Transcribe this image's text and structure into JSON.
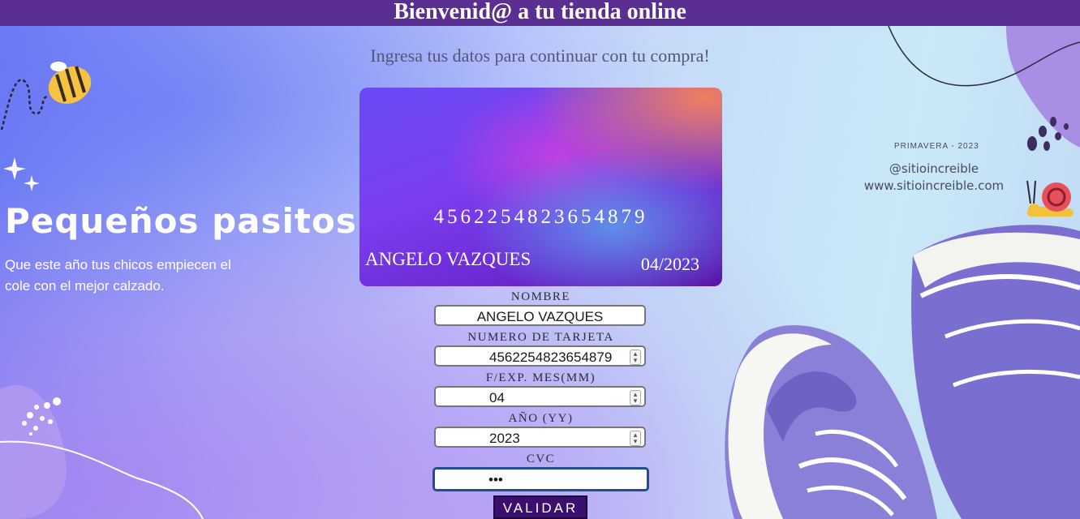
{
  "header": {
    "title": "Bienvenid@ a tu tienda online",
    "subtitle": "Ingresa tus datos para continuar con tu compra!"
  },
  "card": {
    "number": "4562254823654879",
    "holder": "ANGELO VAZQUES",
    "expiry": "04/2023"
  },
  "form": {
    "name_label": "NOMBRE",
    "name_value": "ANGELO VAZQUES",
    "card_label": "NUMERO DE TARJETA",
    "card_value": "4562254823654879",
    "month_label": "F/EXP. MES(MM)",
    "month_value": "04",
    "year_label": "AÑO (YY)",
    "year_value": "2023",
    "cvc_label": "CVC",
    "cvc_value": "•••",
    "submit_label": "VALIDAR"
  },
  "promo": {
    "title": "Pequeños pasitos",
    "text": "Que este año tus chicos empiecen el cole con el mejor calzado.",
    "season": "PRIMAVERA - 2023",
    "handle": "@sitioincreible",
    "website": "www.sitioincreible.com"
  },
  "colors": {
    "header_bg": "#5b2f91",
    "button_bg": "#3b0f6e",
    "shoe_canvas": "#7a6fd0"
  },
  "icons": [
    "bee-icon",
    "sparkle-icon",
    "snail-icon",
    "sneaker-illustration",
    "paw-dots-icon"
  ]
}
